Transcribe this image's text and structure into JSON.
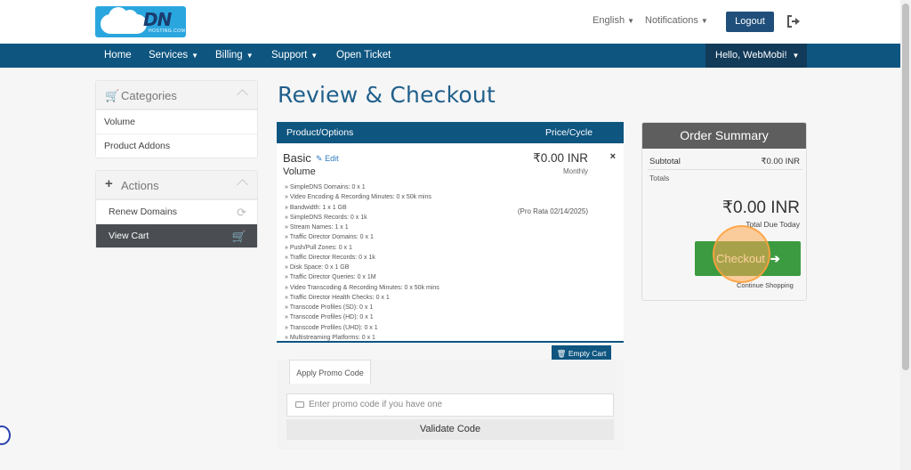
{
  "header": {
    "logo_text": "DN",
    "logo_subtext": "HOSTING.COM",
    "language_label": "English",
    "notifications_label": "Notifications",
    "logout_label": "Logout"
  },
  "nav": {
    "items": [
      {
        "label": "Home",
        "has_dropdown": false
      },
      {
        "label": "Services",
        "has_dropdown": true
      },
      {
        "label": "Billing",
        "has_dropdown": true
      },
      {
        "label": "Support",
        "has_dropdown": true
      },
      {
        "label": "Open Ticket",
        "has_dropdown": false
      }
    ],
    "greeting": "Hello, WebMobi!"
  },
  "sidebar": {
    "categories_title": "Categories",
    "categories": [
      "Volume",
      "Product Addons"
    ],
    "actions_title": "Actions",
    "actions": [
      {
        "label": "Renew Domains",
        "icon": "refresh-icon",
        "active": false
      },
      {
        "label": "View Cart",
        "icon": "cart-icon",
        "active": true
      }
    ]
  },
  "main": {
    "title": "Review & Checkout",
    "table_headers": {
      "product": "Product/Options",
      "price": "Price/Cycle"
    },
    "product": {
      "name": "Basic",
      "edit_label": "Edit",
      "group": "Volume",
      "price": "₹0.00 INR",
      "cycle": "Monthly",
      "pro_rata": "(Pro Rata 02/14/2025)",
      "remove_symbol": "×",
      "options": [
        "» SimpleDNS Domains: 0 x 1",
        "» Video Encoding & Recording Minutes: 0 x 50k mins",
        "» Bandwidth: 1 x 1 GB",
        "» SimpleDNS Records: 0 x 1k",
        "» Stream Names: 1 x 1",
        "» Traffic Director Domains: 0 x 1",
        "» Push/Pull Zones: 0 x 1",
        "» Traffic Director Records: 0 x 1k",
        "» Disk Space: 0 x 1 GB",
        "» Traffic Director Queries: 0 x 1M",
        "» Video Transcoding & Recording Minutes: 0 x 50k mins",
        "» Traffic Director Health Checks: 0 x 1",
        "» Transcode Profiles (SD): 0 x 1",
        "» Transcode Profiles (HD): 0 x 1",
        "» Transcode Profiles (UHD): 0 x 1",
        "» Multistreaming Platforms: 0 x 1"
      ]
    },
    "empty_cart_label": "Empty Cart",
    "promo": {
      "tab_label": "Apply Promo Code",
      "placeholder": "Enter promo code if you have one",
      "validate_label": "Validate Code"
    }
  },
  "summary": {
    "title": "Order Summary",
    "subtotal_label": "Subtotal",
    "subtotal_value": "₹0.00 INR",
    "totals_label": "Totals",
    "total_value": "₹0.00 INR",
    "total_due_label": "Total Due Today",
    "checkout_label": "Checkout",
    "continue_label": "Continue Shopping"
  },
  "colors": {
    "brand_blue": "#0e5580",
    "title_blue": "#1f5f8b",
    "checkout_green": "#3c9a41",
    "summary_head": "#5e5e5e"
  }
}
